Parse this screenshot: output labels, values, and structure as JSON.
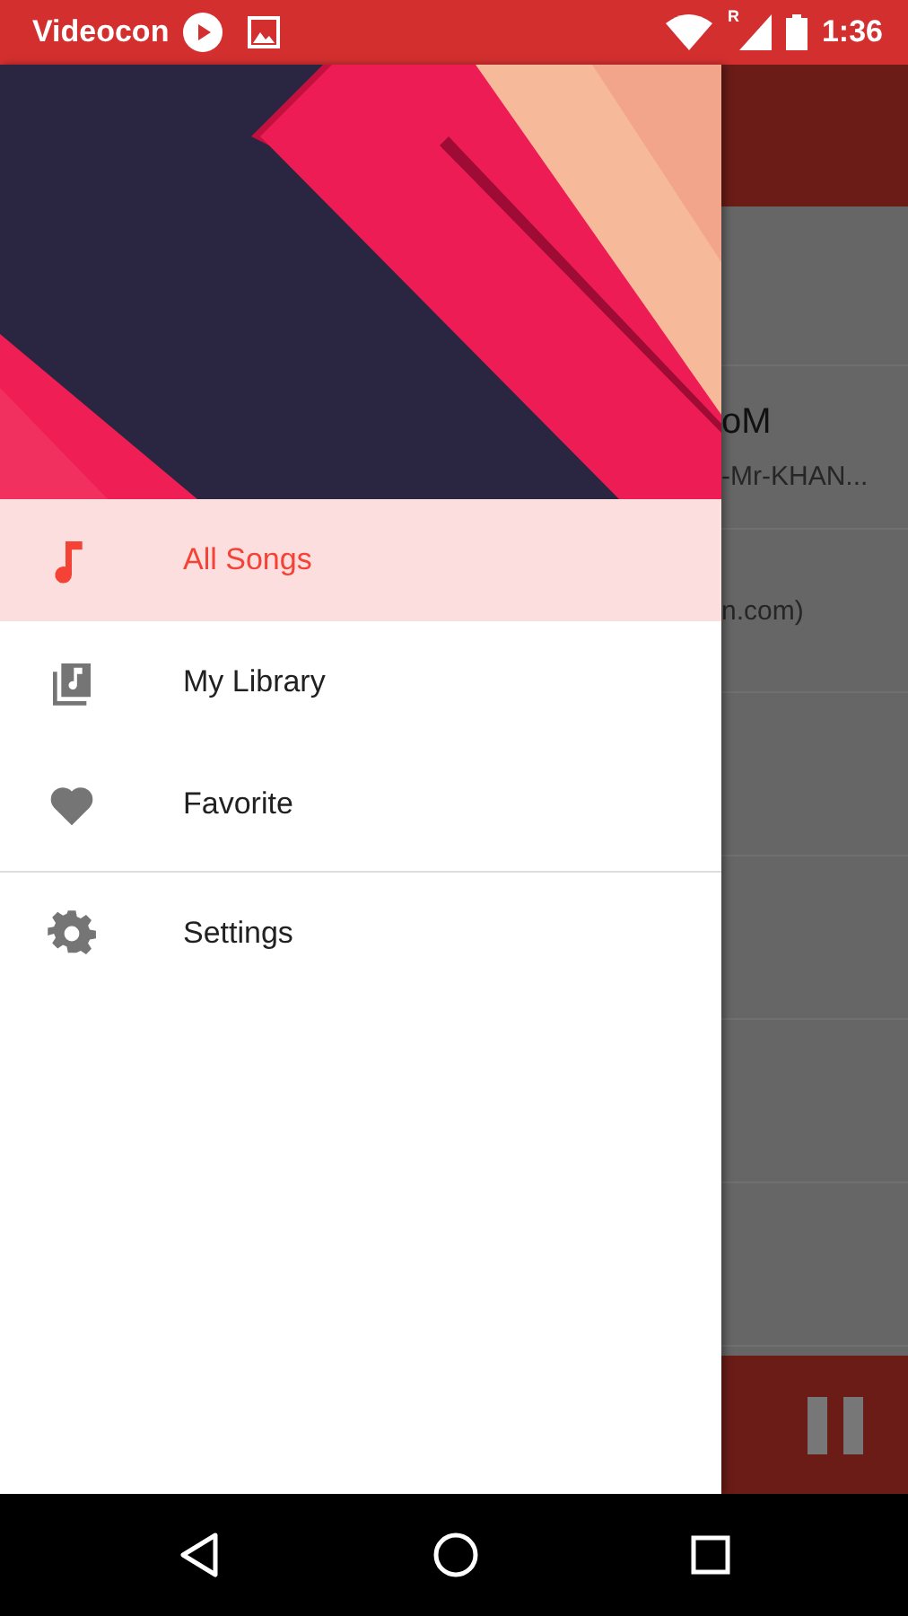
{
  "status_bar": {
    "carrier": "Videocon",
    "roaming": "R",
    "time": "1:36"
  },
  "drawer": {
    "header": {
      "kind": "picture"
    },
    "sections": [
      [
        {
          "label": "All Songs",
          "selected": true
        },
        {
          "label": "My Library",
          "selected": false
        },
        {
          "label": "Favorite",
          "selected": false
        }
      ],
      [
        {
          "label": "Settings",
          "selected": false
        }
      ]
    ]
  },
  "background_list": {
    "rows": [
      {
        "title": "oM",
        "subtitle": "-Mr-KHAN..."
      },
      {
        "subtitle": "n.com)"
      }
    ]
  }
}
